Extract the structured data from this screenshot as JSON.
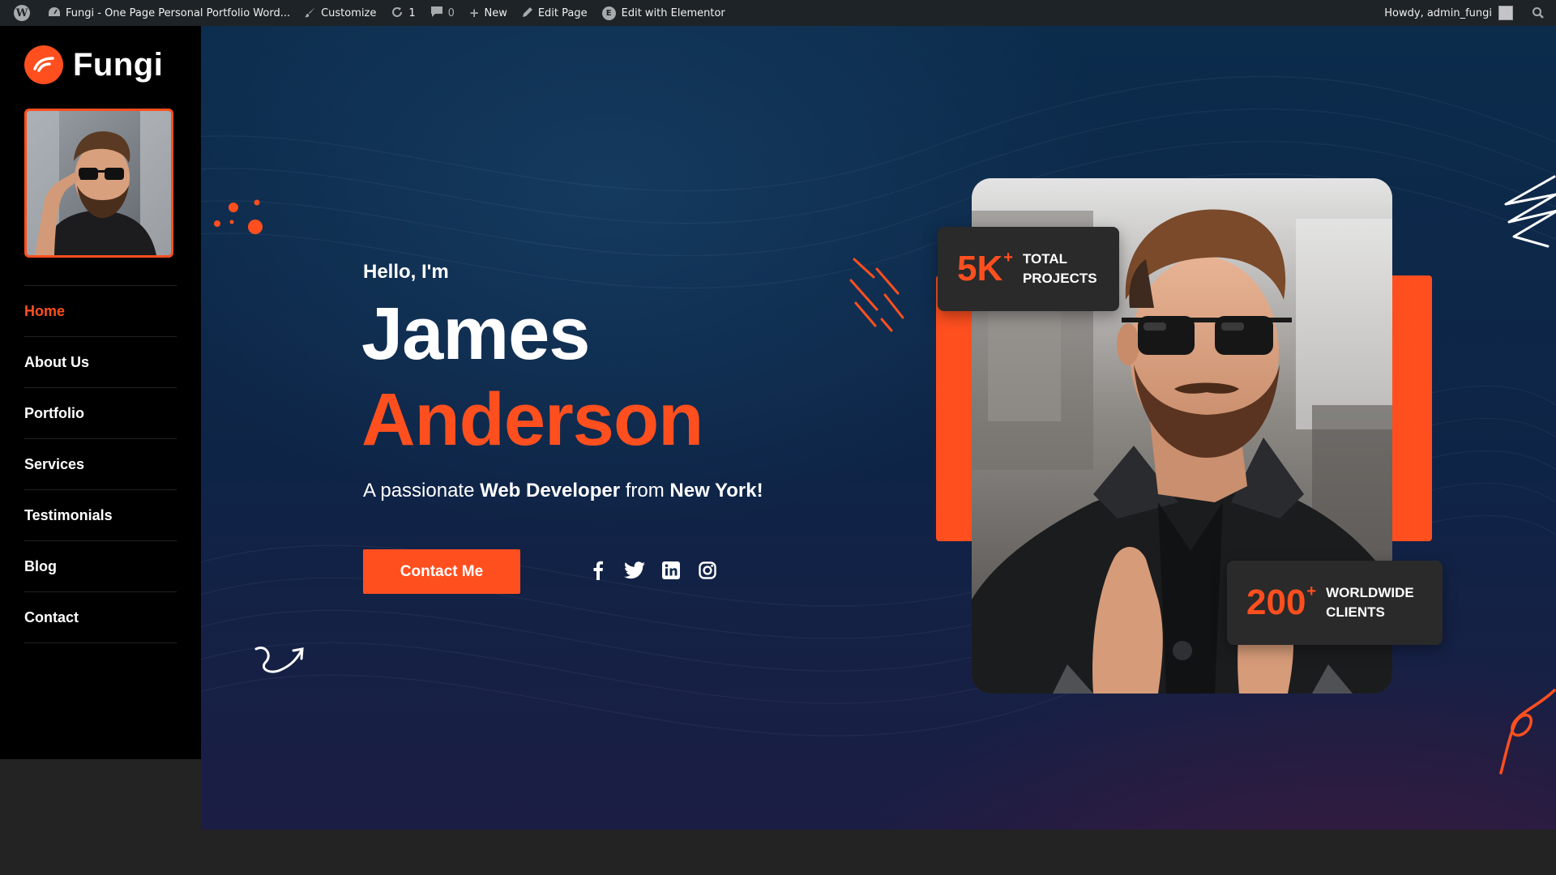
{
  "adminbar": {
    "site_title": "Fungi - One Page Personal Portfolio Word...",
    "customize": "Customize",
    "updates_count": "1",
    "comments_count": "0",
    "new_label": "New",
    "edit_page": "Edit Page",
    "edit_elementor": "Edit with Elementor",
    "greeting": "Howdy, admin_fungi"
  },
  "brand": {
    "name": "Fungi",
    "accent": "#ff4f1f"
  },
  "nav": {
    "items": [
      {
        "label": "Home",
        "active": true
      },
      {
        "label": "About Us"
      },
      {
        "label": "Portfolio"
      },
      {
        "label": "Services"
      },
      {
        "label": "Testimonials"
      },
      {
        "label": "Blog"
      },
      {
        "label": "Contact"
      }
    ]
  },
  "hero": {
    "greeting": "Hello, I'm",
    "first_name": "James",
    "last_name": "Anderson",
    "tagline_pre": "A passionate ",
    "tagline_role": "Web Developer",
    "tagline_mid": " from ",
    "tagline_city": "New York!",
    "cta_label": "Contact Me",
    "socials": [
      "facebook-icon",
      "twitter-icon",
      "linkedin-icon",
      "instagram-icon"
    ]
  },
  "stats": [
    {
      "number": "5K",
      "suffix": "+",
      "line1": "TOTAL",
      "line2": "PROJECTS"
    },
    {
      "number": "200",
      "suffix": "+",
      "line1": "WORLDWIDE",
      "line2": "CLIENTS"
    }
  ]
}
